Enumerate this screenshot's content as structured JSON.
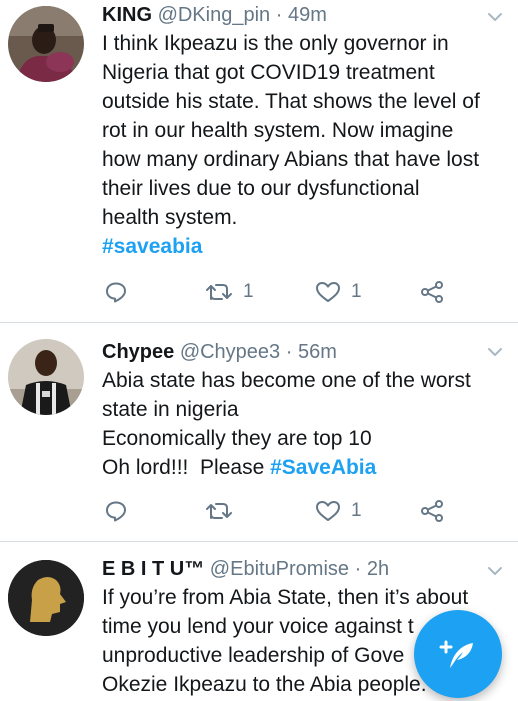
{
  "tweets": [
    {
      "name": "KING",
      "handle": "@DKing_pin",
      "sep": "·",
      "time": "49m",
      "lines": [
        "I think Ikpeazu is the only governor in",
        "Nigeria that got COVID19 treatment",
        "outside his state. That shows the level of",
        "rot in our health system. Now imagine",
        "how many ordinary Abians that have lost",
        "their lives due to our dysfunctional",
        "health system."
      ],
      "hashtag": "#saveabia",
      "retweets": "1",
      "likes": "1"
    },
    {
      "name": "Chypee",
      "handle": "@Chypee3",
      "sep": "·",
      "time": "56m",
      "lines": [
        "Abia state has become one of the worst",
        "state in nigeria",
        "Economically they are top 10"
      ],
      "last_line_prefix": "Oh lord!!!  Please ",
      "hashtag": "#SaveAbia",
      "retweets": "",
      "likes": "1"
    },
    {
      "name": "E B I T U™",
      "handle": "@EbituPromise",
      "sep": "·",
      "time": "2h",
      "lines": [
        "If you’re from Abia State, then it’s about",
        "time you lend your voice against t",
        "unproductive leadership of Gove",
        "Okezie Ikpeazu to the Abia people."
      ]
    }
  ],
  "icons": {
    "reply": "reply-icon",
    "retweet": "retweet-icon",
    "like": "heart-icon",
    "share": "share-icon",
    "more": "chevron-down-icon",
    "compose": "compose-tweet-icon"
  },
  "colors": {
    "accent": "#1da1f2",
    "secondary_text": "#657786",
    "divider": "#d9dee2"
  }
}
